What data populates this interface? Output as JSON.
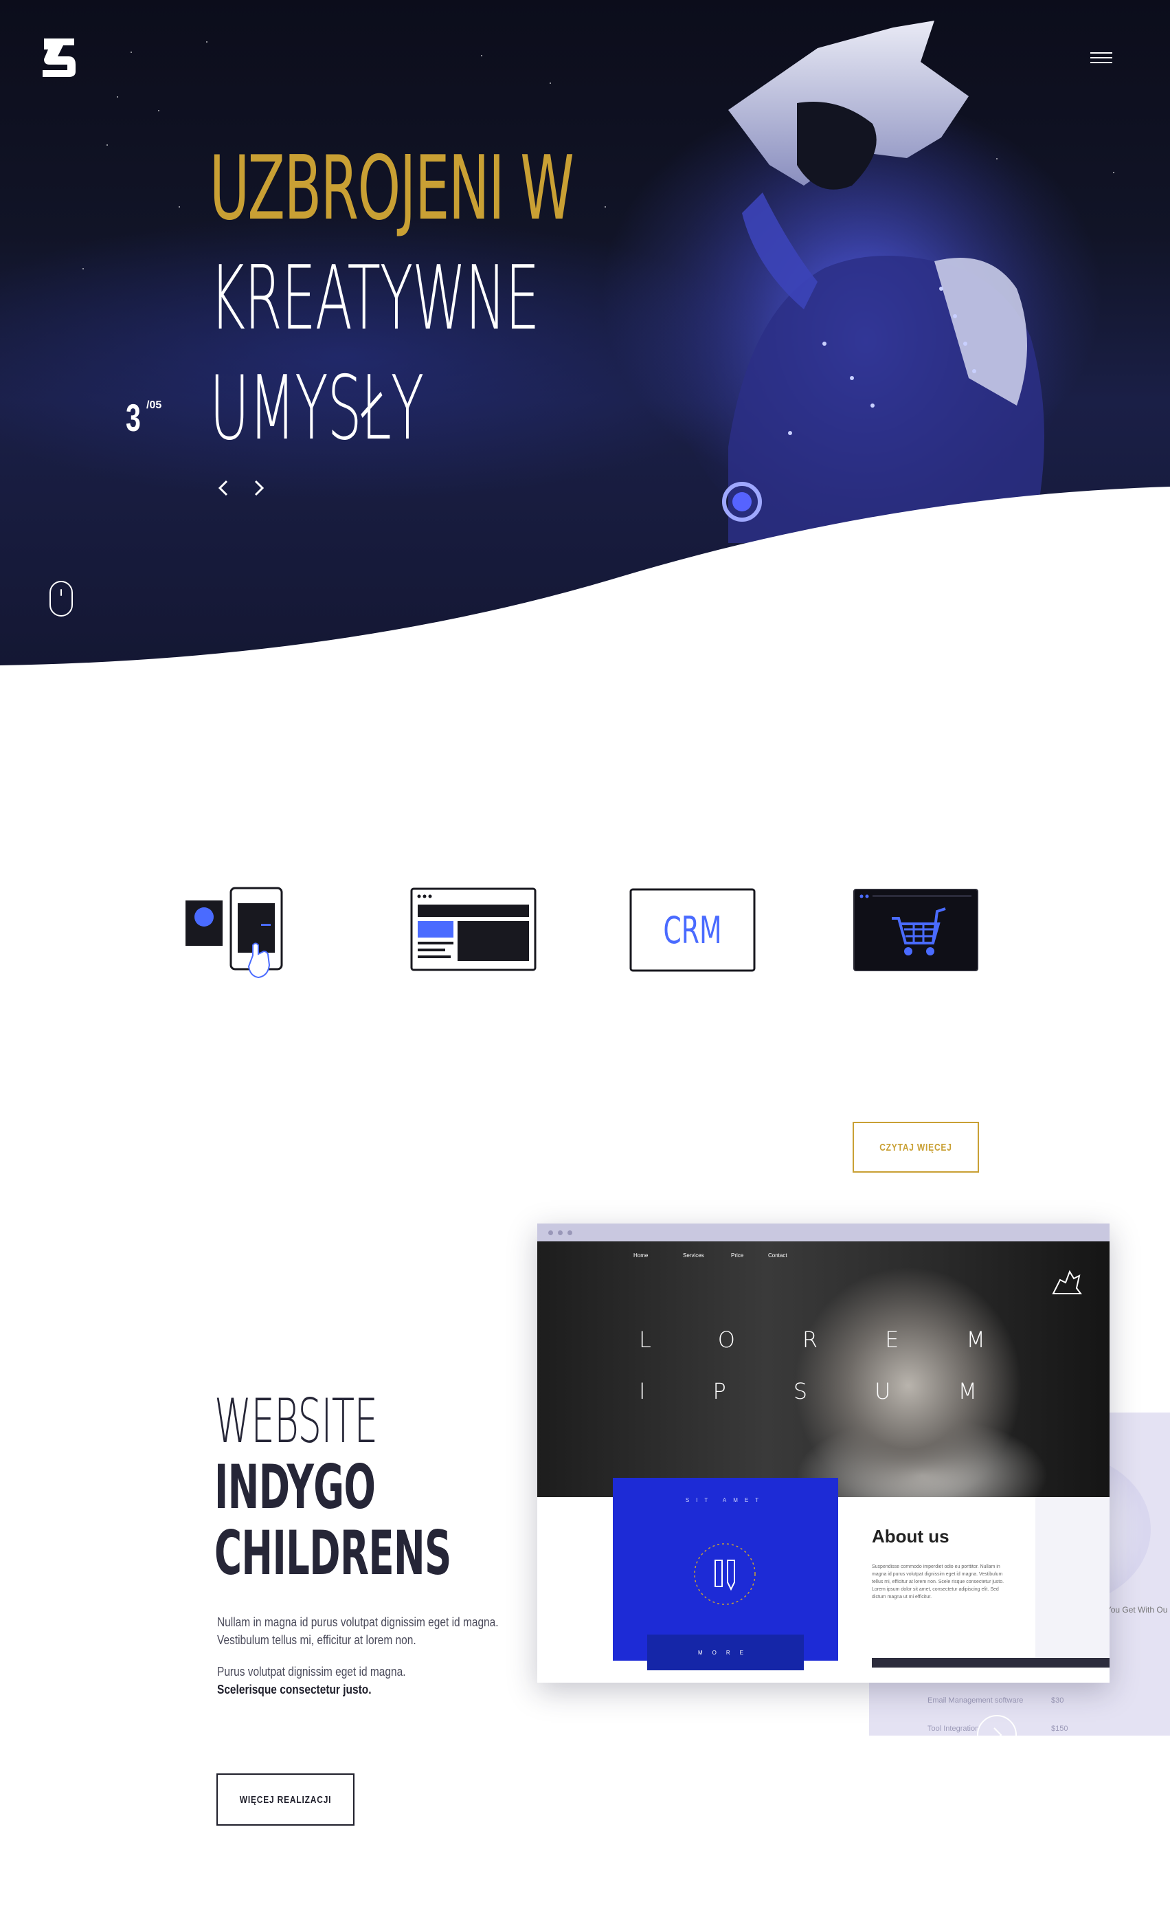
{
  "hero": {
    "title_line1": "UZBROJENI W",
    "title_line2": "KREATYWNE",
    "title_line3": "UMYSŁY",
    "slide_current": "3",
    "slide_total": "/05"
  },
  "colors": {
    "accent_gold": "#c9a034",
    "brand_blue": "#1d2bd6",
    "hero_dark": "#0c0d1b"
  },
  "services": {
    "items": [
      {
        "icon": "mobile-app-icon"
      },
      {
        "icon": "website-layout-icon"
      },
      {
        "icon": "crm-icon",
        "label": "CRM"
      },
      {
        "icon": "shopping-cart-icon"
      }
    ]
  },
  "buttons": {
    "read_more": "CZYTAJ WIĘCEJ",
    "more_projects": "WIĘCEJ REALIZACJI"
  },
  "project": {
    "title_line1": "WEBSITE",
    "title_line2": "INDYGO",
    "title_line3": "CHILDRENS",
    "desc_p1": "Nullam in magna id purus volutpat dignissim eget id magna. Vestibulum tellus mi, efficitur at lorem non.",
    "desc_p2": "Purus volutpat dignissim eget id magna.",
    "desc_p2_bold": "Scelerisque consectetur justo."
  },
  "mockup": {
    "nav": [
      "Home",
      "Services",
      "Price",
      "Contact"
    ],
    "lorem": "LOREM",
    "ipsum": "IPSUM",
    "sit_amet": "SIT AMET",
    "more": "MORE",
    "about_title": "About us",
    "about_text": "Suspendisse commodo imperdiet odio eu porttitor. Nullam in magna id purus volutpat dignissim eget id magna. Vestibulum tellus mi, efficitur at lorem non. Scele risque consectetur justo. Lorem ipsum dolor sit amet, consectetur adipiscing elit. Sed dictum magna ut mi efficitur.",
    "back_caption": "g You Get With Ou",
    "back_row1": "Email Management software",
    "back_row1_price": "$30",
    "back_row2": "Tool Integration",
    "back_row2_price": "$150"
  }
}
